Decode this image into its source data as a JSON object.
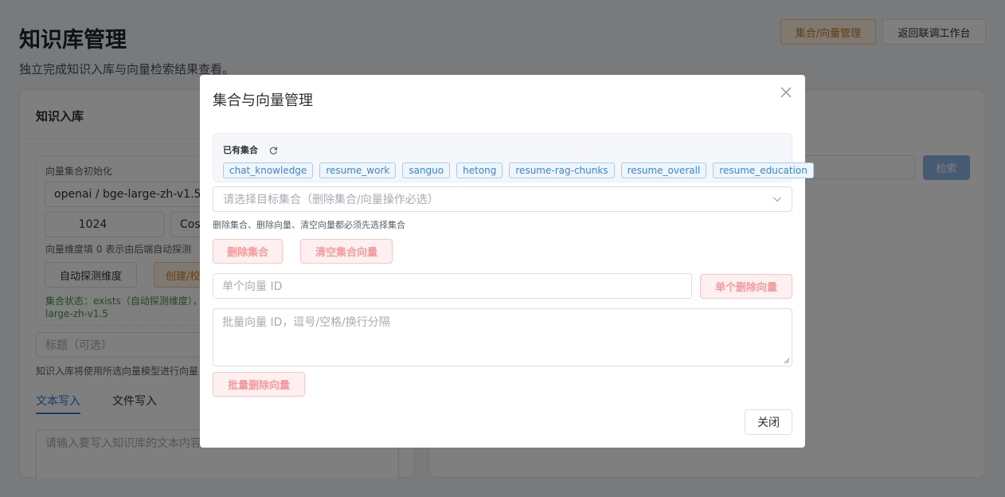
{
  "page": {
    "title": "知识库管理",
    "subtitle": "独立完成知识入库与向量检索结果查看。",
    "btn_collection_mgmt": "集合/向量管理",
    "btn_back": "返回联调工作台"
  },
  "left_card": {
    "title": "知识入库",
    "init_label": "向量集合初始化",
    "model_value": "openai / bge-large-zh-v1.5",
    "dimension_value": "1024",
    "metric_value": "Cos",
    "dimension_hint": "向量维度填 0 表示由后端自动探测",
    "btn_auto_detect": "自动探测维度",
    "btn_create": "创建/校",
    "status_line1": "集合状态：exists（自动探测维度），",
    "status_line2": "large-zh-v1.5",
    "title_placeholder": "标题（可选）",
    "model_hint": "知识入库将使用所选向量模型进行向量",
    "tab_text": "文本写入",
    "tab_file": "文件写入",
    "content_placeholder": "请输入要写入知识库的文本内容"
  },
  "right_card": {
    "search_button": "检索"
  },
  "modal": {
    "title": "集合与向量管理",
    "collections_label": "已有集合",
    "collections": [
      "chat_knowledge",
      "resume_work",
      "sanguo",
      "hetong",
      "resume-rag-chunks",
      "resume_overall",
      "resume_education"
    ],
    "select_placeholder": "请选择目标集合（删除集合/向量操作必选）",
    "hint": "删除集合、删除向量、清空向量都必须先选择集合",
    "btn_delete_collection": "删除集合",
    "btn_clear_vectors": "清空集合向量",
    "single_id_placeholder": "单个向量 ID",
    "btn_delete_single": "单个删除向量",
    "batch_ids_placeholder": "批量向量 ID，逗号/空格/换行分隔",
    "btn_batch_delete": "批量删除向量",
    "btn_close": "关闭"
  },
  "colors": {
    "accent": "#3a86d4",
    "danger_text": "#f59a9a",
    "warning": "#c77c1d",
    "success": "#3f9b3a"
  },
  "icons": [
    "refresh-icon",
    "close-icon",
    "chevron-down-icon",
    "stepper-up-icon",
    "stepper-down-icon"
  ]
}
